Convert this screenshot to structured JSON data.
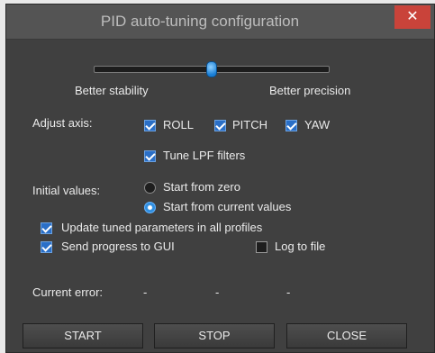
{
  "window": {
    "title": "PID auto-tuning configuration",
    "close_glyph": "✕"
  },
  "slider": {
    "left_label": "Better stability",
    "right_label": "Better precision",
    "level": 0.5
  },
  "axis": {
    "label": "Adjust axis:",
    "roll": {
      "label": "ROLL",
      "checked": true
    },
    "pitch": {
      "label": "PITCH",
      "checked": true
    },
    "yaw": {
      "label": "YAW",
      "checked": true
    },
    "lpf": {
      "label": "Tune LPF filters",
      "checked": true
    }
  },
  "initial": {
    "label": "Initial values:",
    "zero": {
      "label": "Start from zero",
      "selected": false
    },
    "current": {
      "label": "Start from current values",
      "selected": true
    }
  },
  "options": {
    "update_profiles": {
      "label": "Update tuned parameters in all profiles",
      "checked": true
    },
    "send_progress": {
      "label": "Send progress to GUI",
      "checked": true
    },
    "log_file": {
      "label": "Log to file",
      "checked": false
    }
  },
  "error": {
    "label": "Current error:",
    "values": [
      "-",
      "-",
      "-"
    ]
  },
  "buttons": {
    "start": "START",
    "stop": "STOP",
    "close": "CLOSE"
  },
  "colors": {
    "accent": "#2a6fc7",
    "close_red": "#c9433a",
    "background": "#404040"
  }
}
